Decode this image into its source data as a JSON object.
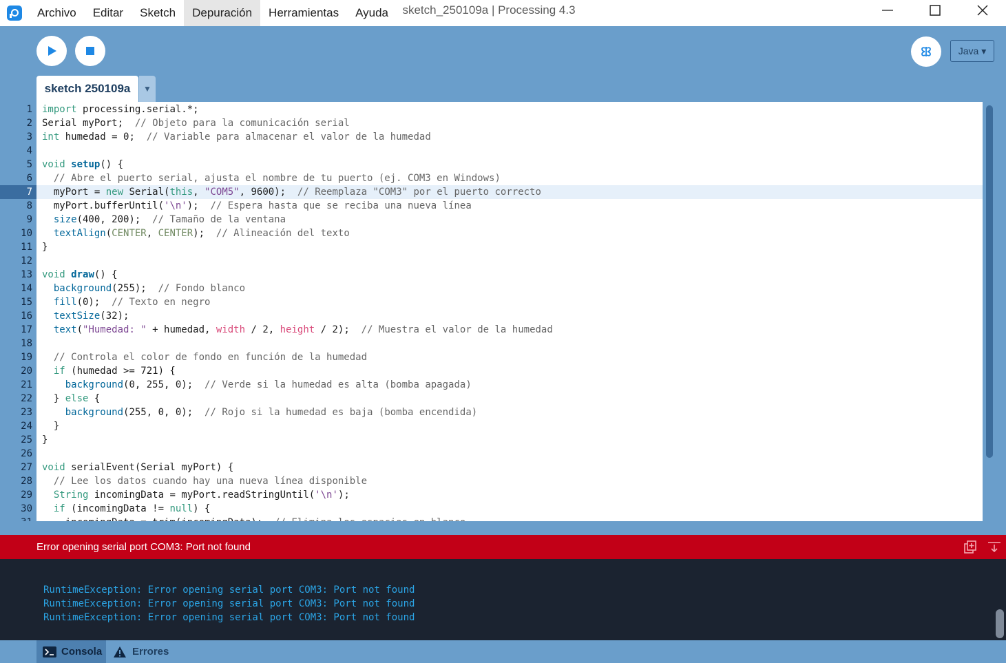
{
  "menu": {
    "items": [
      {
        "label": "Archivo"
      },
      {
        "label": "Editar"
      },
      {
        "label": "Sketch"
      },
      {
        "label": "Depuración"
      },
      {
        "label": "Herramientas"
      },
      {
        "label": "Ayuda"
      }
    ],
    "active_index": 3
  },
  "window": {
    "title": "sketch_250109a | Processing 4.3"
  },
  "toolbar": {
    "run_icon": "play-icon",
    "stop_icon": "stop-icon",
    "debugger_icon": "butterfly-icon",
    "mode_label": "Java ▾"
  },
  "tabs": [
    {
      "label": "sketch 250109a"
    }
  ],
  "editor": {
    "current_line": 7,
    "lines": [
      "import processing.serial.*;",
      "Serial myPort;  // Objeto para la comunicación serial",
      "int humedad = 0;  // Variable para almacenar el valor de la humedad",
      "",
      "void setup() {",
      "  // Abre el puerto serial, ajusta el nombre de tu puerto (ej. COM3 en Windows)",
      "  myPort = new Serial(this, \"COM5\", 9600);  // Reemplaza \"COM3\" por el puerto correcto",
      "  myPort.bufferUntil('\\n');  // Espera hasta que se reciba una nueva línea",
      "  size(400, 200);  // Tamaño de la ventana",
      "  textAlign(CENTER, CENTER);  // Alineación del texto",
      "}",
      "",
      "void draw() {",
      "  background(255);  // Fondo blanco",
      "  fill(0);  // Texto en negro",
      "  textSize(32);",
      "  text(\"Humedad: \" + humedad, width / 2, height / 2);  // Muestra el valor de la humedad",
      "",
      "  // Controla el color de fondo en función de la humedad",
      "  if (humedad >= 721) {",
      "    background(0, 255, 0);  // Verde si la humedad es alta (bomba apagada)",
      "  } else {",
      "    background(255, 0, 0);  // Rojo si la humedad es baja (bomba encendida)",
      "  }",
      "}",
      "",
      "void serialEvent(Serial myPort) {",
      "  // Lee los datos cuando hay una nueva línea disponible",
      "  String incomingData = myPort.readStringUntil('\\n');",
      "  if (incomingData != null) {",
      "    incomingData = trim(incomingData);  // Elimina los espacios en blanco"
    ]
  },
  "error_bar": {
    "message": "Error opening serial port COM3: Port not found"
  },
  "console": {
    "lines": [
      "RuntimeException: Error opening serial port COM3: Port not found",
      "RuntimeException: Error opening serial port COM3: Port not found",
      "RuntimeException: Error opening serial port COM3: Port not found"
    ]
  },
  "footer": {
    "console_label": "Consola",
    "errors_label": "Errores"
  },
  "colors": {
    "chrome": "#6a9ecb",
    "error": "#c20017",
    "console_bg": "#1b2330",
    "console_text": "#2ba5e6"
  }
}
